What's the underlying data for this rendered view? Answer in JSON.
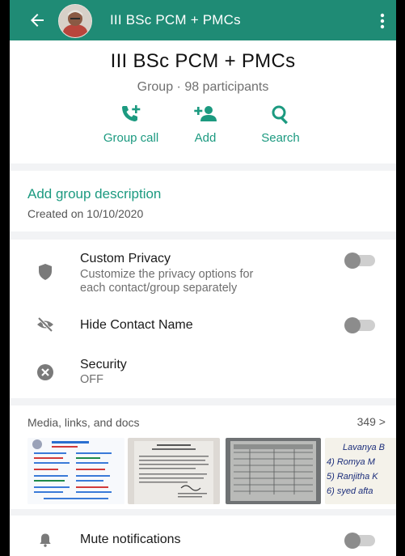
{
  "topbar": {
    "title": "III BSc PCM + PMCs",
    "bg_color": "#1f8b75"
  },
  "header": {
    "group_name": "III BSc PCM + PMCs",
    "subtitle": "Group · 98 participants",
    "actions": [
      {
        "label": "Group call",
        "icon": "group-call-icon"
      },
      {
        "label": "Add",
        "icon": "add-person-icon"
      },
      {
        "label": "Search",
        "icon": "search-icon"
      }
    ],
    "accent_color": "#1c9a80"
  },
  "description": {
    "add_label": "Add group description",
    "created": "Created on 10/10/2020"
  },
  "privacy": {
    "custom_privacy": {
      "title": "Custom Privacy",
      "desc_line1": "Customize the privacy options for",
      "desc_line2": "each contact/group separately",
      "enabled": false
    },
    "hide_contact_name": {
      "title": "Hide Contact Name",
      "enabled": false
    },
    "security": {
      "title": "Security",
      "status": "OFF"
    }
  },
  "media": {
    "title": "Media, links, and docs",
    "count": "349 >",
    "thumb_handwriting": [
      "Lavanya B",
      "4) Romya M",
      "5) Ranjitha K",
      "6) syed afta"
    ]
  },
  "mute": {
    "title": "Mute notifications",
    "enabled": false
  }
}
